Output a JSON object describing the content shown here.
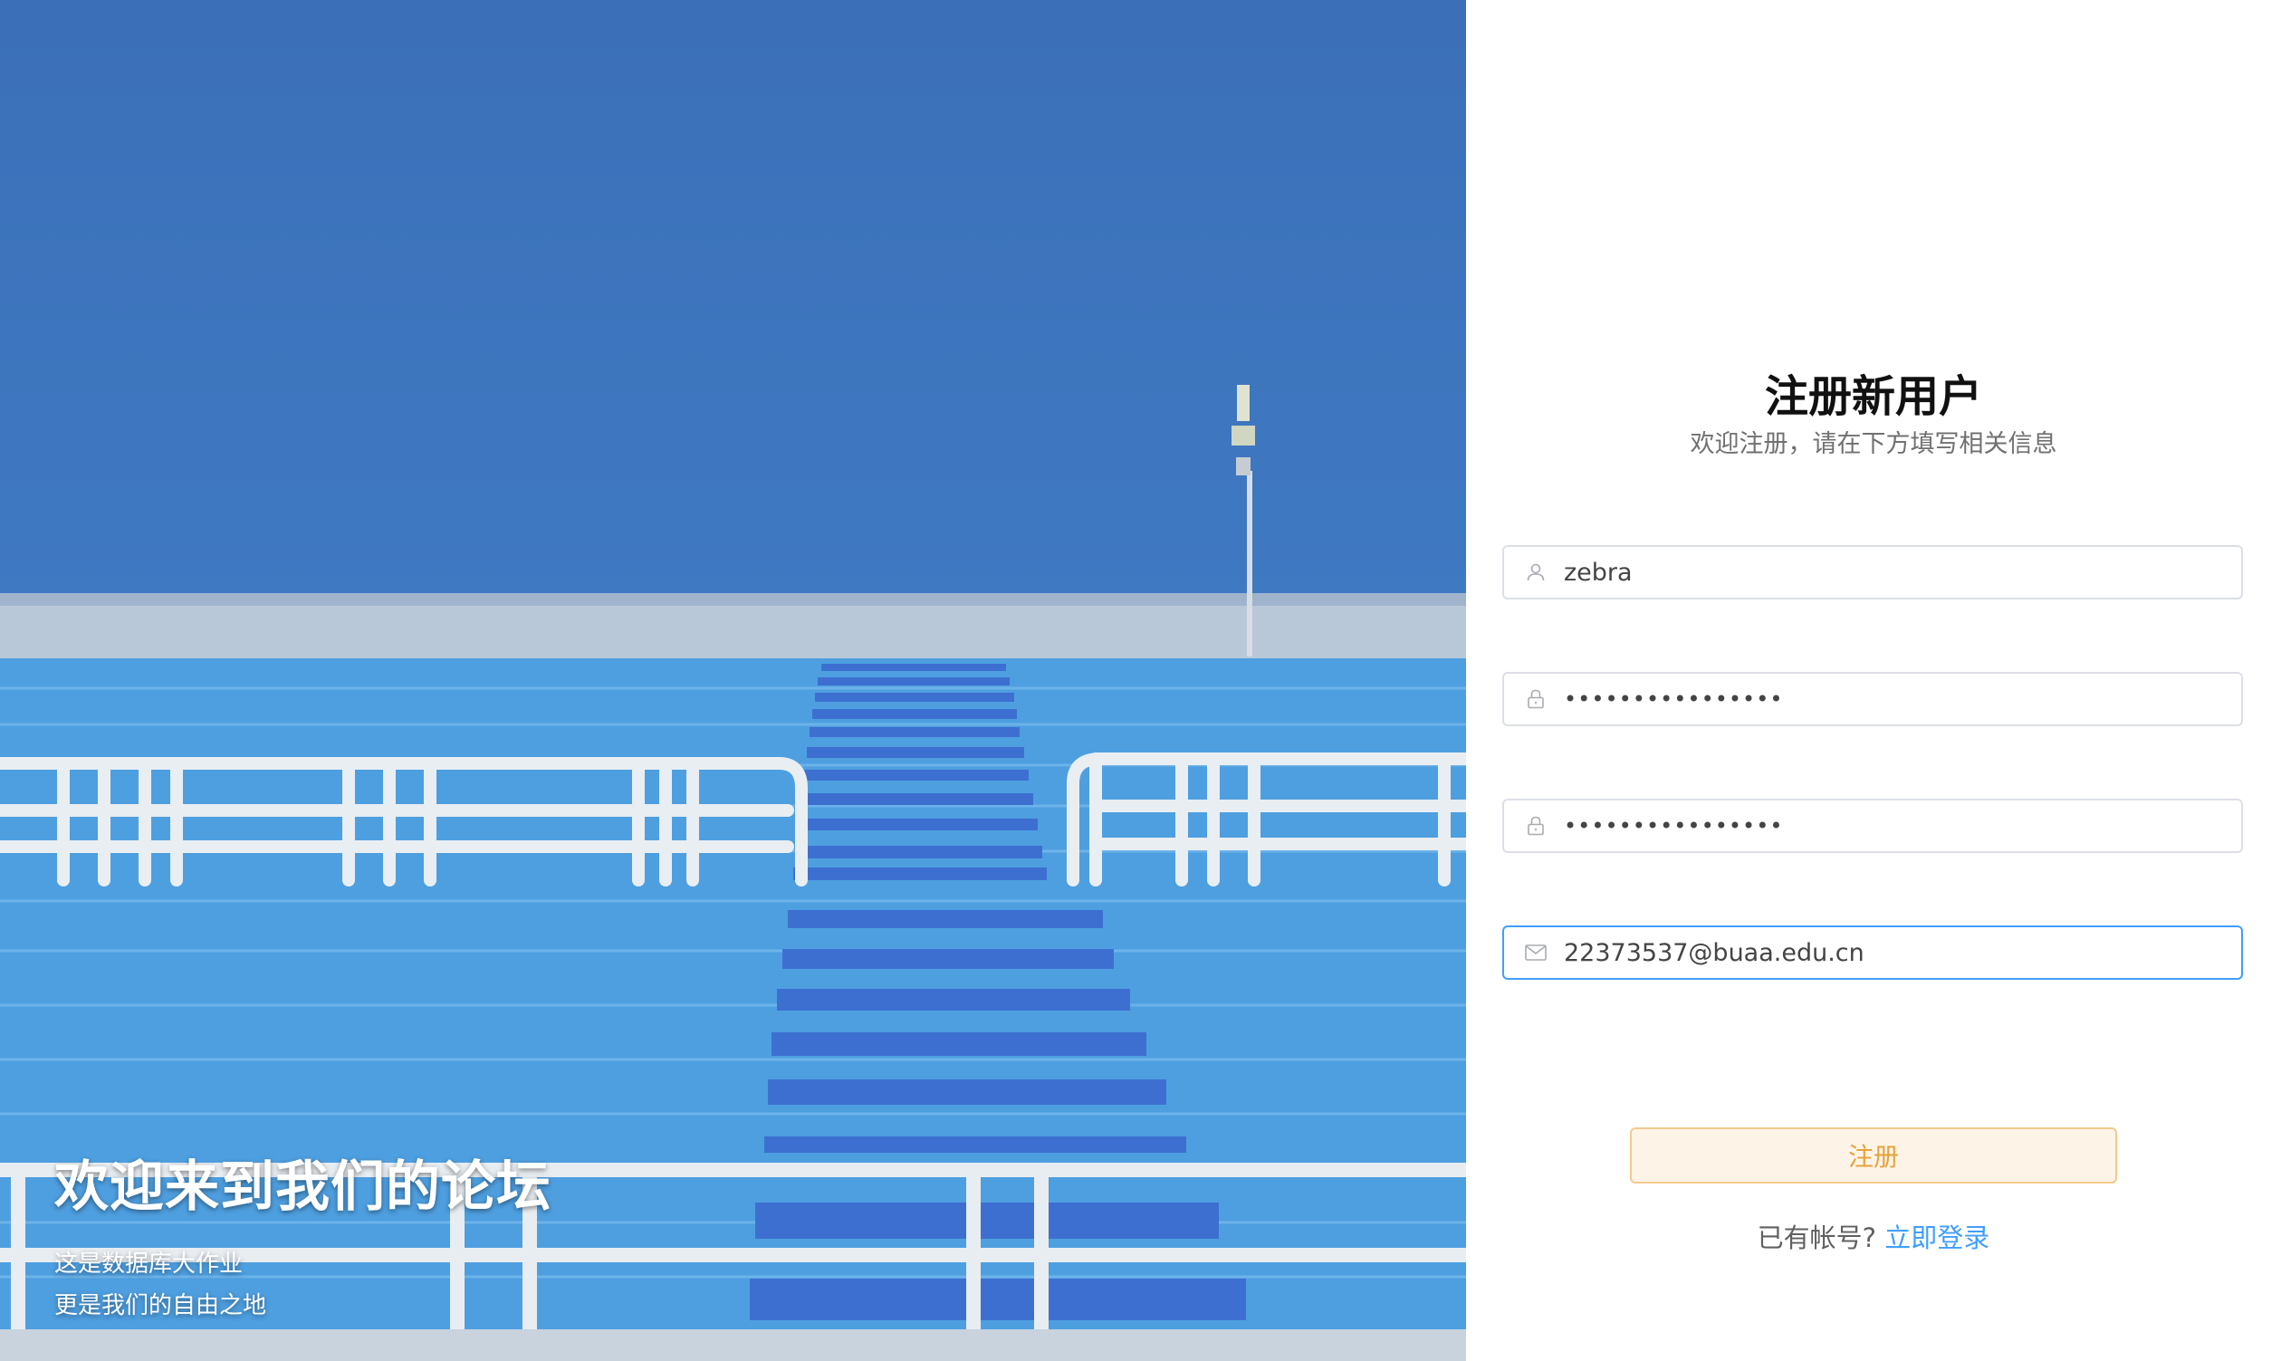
{
  "hero": {
    "title": "欢迎来到我们的论坛",
    "lines": [
      "这是数据库大作业",
      "更是我们的自由之地"
    ]
  },
  "form": {
    "title": "注册新用户",
    "subtitle": "欢迎注册，请在下方填写相关信息",
    "fields": [
      {
        "name": "username",
        "icon": "user-icon",
        "value": "zebra"
      },
      {
        "name": "password",
        "icon": "lock-icon",
        "value": "••••••••••••••••"
      },
      {
        "name": "confirm-password",
        "icon": "lock-icon",
        "value": "••••••••••••••••"
      },
      {
        "name": "email",
        "icon": "mail-icon",
        "value": "22373537@buaa.edu.cn",
        "focused": true
      }
    ],
    "submit_label": "注册",
    "has_account_prompt": "已有帐号?",
    "login_link": "立即登录"
  },
  "colors": {
    "accent": "#409eff",
    "button_text": "#e6a23c",
    "button_bg": "#fdf4e7",
    "sky": "#3a73bd",
    "stand": "#4a9de0"
  }
}
